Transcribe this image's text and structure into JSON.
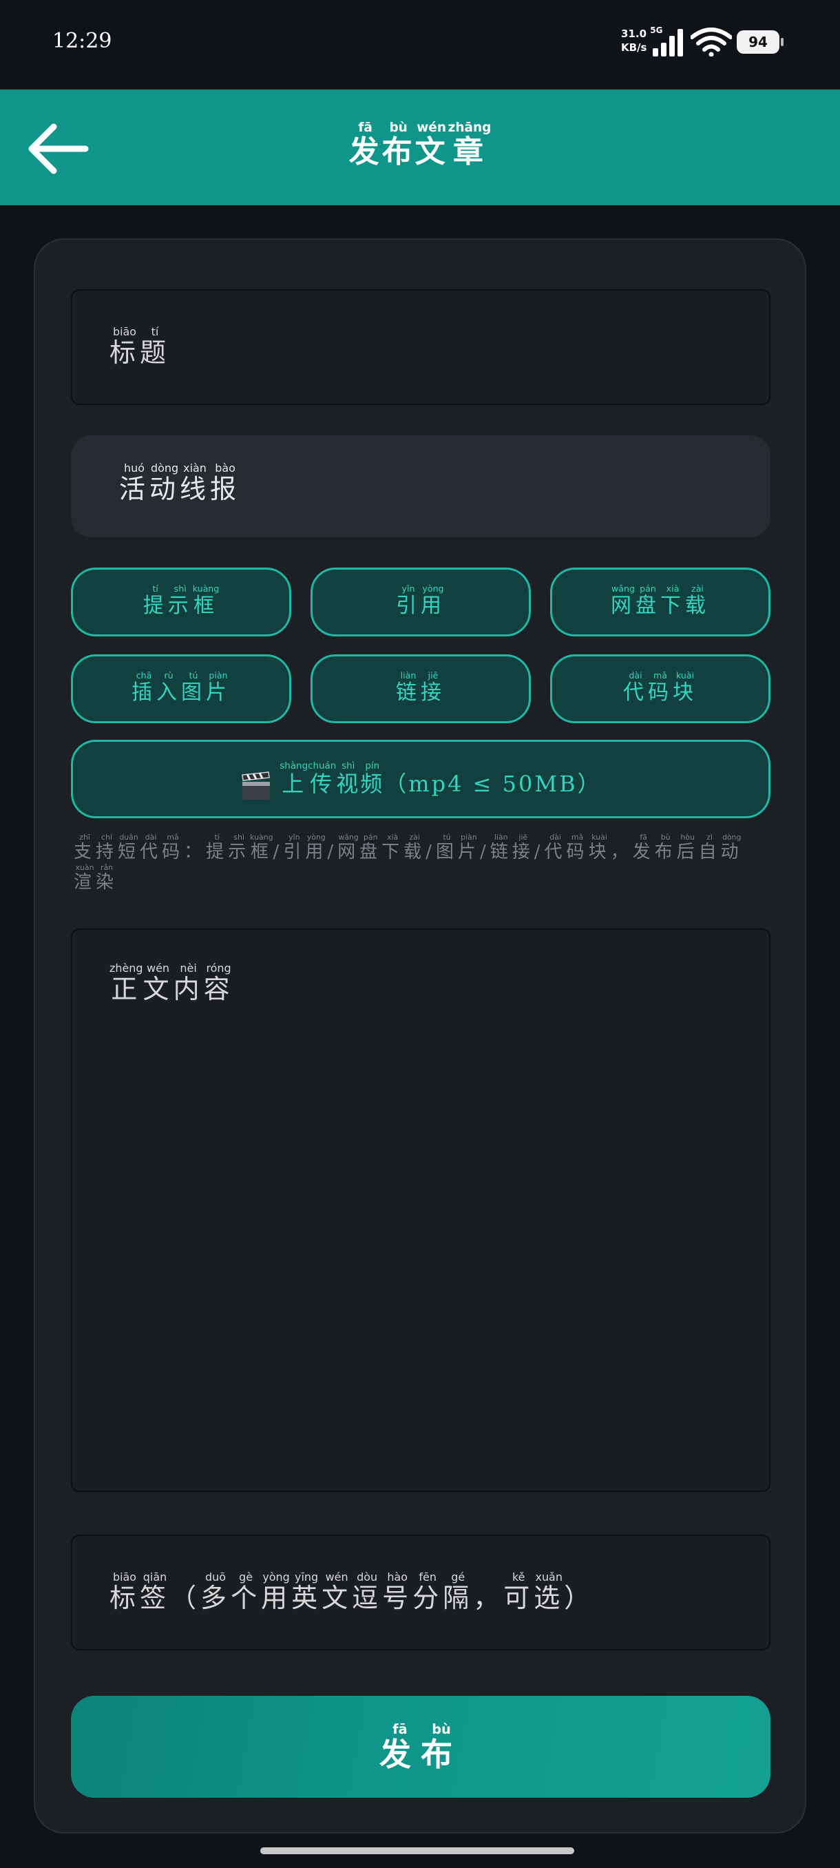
{
  "status": {
    "time": "12:29",
    "speed_value": "31.0",
    "network": "5G",
    "speed_unit": "KB/s",
    "battery": "94"
  },
  "header": {
    "back_icon": "arrow-left-icon",
    "title_chars": [
      {
        "c": "发",
        "p": "fā"
      },
      {
        "c": "布",
        "p": "bù"
      },
      {
        "c": "文",
        "p": "wén"
      },
      {
        "c": "章",
        "p": "zhāng"
      }
    ]
  },
  "form": {
    "title_placeholder": [
      {
        "c": "标",
        "p": "biāo"
      },
      {
        "c": "题",
        "p": "tí"
      }
    ],
    "category_placeholder": [
      {
        "c": "活",
        "p": "huó"
      },
      {
        "c": "动",
        "p": "dòng"
      },
      {
        "c": "线",
        "p": "xiàn"
      },
      {
        "c": "报",
        "p": "bào"
      }
    ],
    "toolbar": [
      [
        {
          "c": "提",
          "p": "tí"
        },
        {
          "c": "示",
          "p": "shì"
        },
        {
          "c": "框",
          "p": "kuàng"
        }
      ],
      [
        {
          "c": "引",
          "p": "yǐn"
        },
        {
          "c": "用",
          "p": "yòng"
        }
      ],
      [
        {
          "c": "网",
          "p": "wǎng"
        },
        {
          "c": "盘",
          "p": "pán"
        },
        {
          "c": "下",
          "p": "xià"
        },
        {
          "c": "载",
          "p": "zài"
        }
      ],
      [
        {
          "c": "插",
          "p": "chā"
        },
        {
          "c": "入",
          "p": "rù"
        },
        {
          "c": "图",
          "p": "tú"
        },
        {
          "c": "片",
          "p": "piàn"
        }
      ],
      [
        {
          "c": "链",
          "p": "liàn"
        },
        {
          "c": "接",
          "p": "jiē"
        }
      ],
      [
        {
          "c": "代",
          "p": "dài"
        },
        {
          "c": "码",
          "p": "mǎ"
        },
        {
          "c": "块",
          "p": "kuài"
        }
      ]
    ],
    "video_button": {
      "icon": "clapperboard-icon",
      "chars": [
        {
          "c": "上",
          "p": "shàng"
        },
        {
          "c": "传",
          "p": "chuán"
        },
        {
          "c": "视",
          "p": "shì"
        },
        {
          "c": "频",
          "p": "pín"
        }
      ],
      "suffix": "（mp4 ≤ 50MB）"
    },
    "hint": [
      {
        "c": "支",
        "p": "zhī"
      },
      {
        "c": "持",
        "p": "chí"
      },
      {
        "c": "短",
        "p": "duǎn"
      },
      {
        "c": "代",
        "p": "dài"
      },
      {
        "c": "码",
        "p": "mǎ"
      },
      {
        "c": "：",
        "p": ""
      },
      {
        "c": "提",
        "p": "tí"
      },
      {
        "c": "示",
        "p": "shì"
      },
      {
        "c": "框",
        "p": "kuàng"
      },
      {
        "c": "/",
        "p": ""
      },
      {
        "c": "引",
        "p": "yǐn"
      },
      {
        "c": "用",
        "p": "yòng"
      },
      {
        "c": "/",
        "p": ""
      },
      {
        "c": "网",
        "p": "wǎng"
      },
      {
        "c": "盘",
        "p": "pán"
      },
      {
        "c": "下",
        "p": "xià"
      },
      {
        "c": "载",
        "p": "zài"
      },
      {
        "c": "/",
        "p": ""
      },
      {
        "c": "图",
        "p": "tú"
      },
      {
        "c": "片",
        "p": "piàn"
      },
      {
        "c": "/",
        "p": ""
      },
      {
        "c": "链",
        "p": "liàn"
      },
      {
        "c": "接",
        "p": "jiē"
      },
      {
        "c": "/",
        "p": ""
      },
      {
        "c": "代",
        "p": "dài"
      },
      {
        "c": "码",
        "p": "mǎ"
      },
      {
        "c": "块",
        "p": "kuài"
      },
      {
        "c": "，",
        "p": ""
      },
      {
        "c": "发",
        "p": "fā"
      },
      {
        "c": "布",
        "p": "bù"
      },
      {
        "c": "后",
        "p": "hòu"
      },
      {
        "c": "自",
        "p": "zì"
      },
      {
        "c": "动",
        "p": "dòng"
      },
      {
        "c": "渲",
        "p": "xuàn"
      },
      {
        "c": "染",
        "p": "rǎn"
      }
    ],
    "content_placeholder": [
      {
        "c": "正",
        "p": "zhèng"
      },
      {
        "c": "文",
        "p": "wén"
      },
      {
        "c": "内",
        "p": "nèi"
      },
      {
        "c": "容",
        "p": "róng"
      }
    ],
    "tags_placeholder": [
      {
        "c": "标",
        "p": "biāo"
      },
      {
        "c": "签",
        "p": "qiān"
      },
      {
        "c": "（",
        "p": ""
      },
      {
        "c": "多",
        "p": "duō"
      },
      {
        "c": "个",
        "p": "gè"
      },
      {
        "c": "用",
        "p": "yòng"
      },
      {
        "c": "英",
        "p": "yīng"
      },
      {
        "c": "文",
        "p": "wén"
      },
      {
        "c": "逗",
        "p": "dòu"
      },
      {
        "c": "号",
        "p": "hào"
      },
      {
        "c": "分",
        "p": "fēn"
      },
      {
        "c": "隔",
        "p": "gé"
      },
      {
        "c": "，",
        "p": ""
      },
      {
        "c": "可",
        "p": "kě"
      },
      {
        "c": "选",
        "p": "xuǎn"
      },
      {
        "c": "）",
        "p": ""
      }
    ],
    "publish_button": [
      {
        "c": "发",
        "p": "fā"
      },
      {
        "c": "布",
        "p": "bù"
      }
    ]
  },
  "colors": {
    "accent": "#0f958a",
    "button_border": "#1fb8a5",
    "button_text": "#33d5c0"
  }
}
